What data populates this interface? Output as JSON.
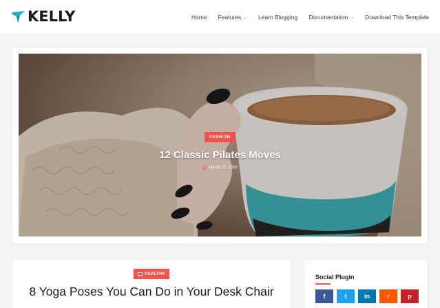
{
  "brand": {
    "name": "KELLY",
    "accent": "#1ab2c8"
  },
  "nav": {
    "items": [
      {
        "label": "Home",
        "dropdown": false
      },
      {
        "label": "Features",
        "dropdown": true
      },
      {
        "label": "Learn Blogging",
        "dropdown": false
      },
      {
        "label": "Documentation",
        "dropdown": true
      },
      {
        "label": "Download This Template",
        "dropdown": false
      }
    ]
  },
  "featured": {
    "tag": "FASHION",
    "title": "12 Classic Pilates Moves",
    "date": "March 17, 2018"
  },
  "post": {
    "tag": "HEALTHY",
    "title": "8 Yoga Poses You Can Do in Your Desk Chair"
  },
  "widget": {
    "title": "Social Plugin",
    "socials": [
      {
        "icon": "facebook-icon",
        "glyph": "f",
        "color": "#3b5998"
      },
      {
        "icon": "twitter-icon",
        "glyph": "t",
        "color": "#1da1f2"
      },
      {
        "icon": "linkedin-icon",
        "glyph": "in",
        "color": "#0077b5"
      },
      {
        "icon": "reddit-icon",
        "glyph": "r",
        "color": "#ff5700"
      },
      {
        "icon": "pinterest-icon",
        "glyph": "p",
        "color": "#ca2127"
      }
    ]
  },
  "colors": {
    "accent_red": "#f7524a"
  }
}
